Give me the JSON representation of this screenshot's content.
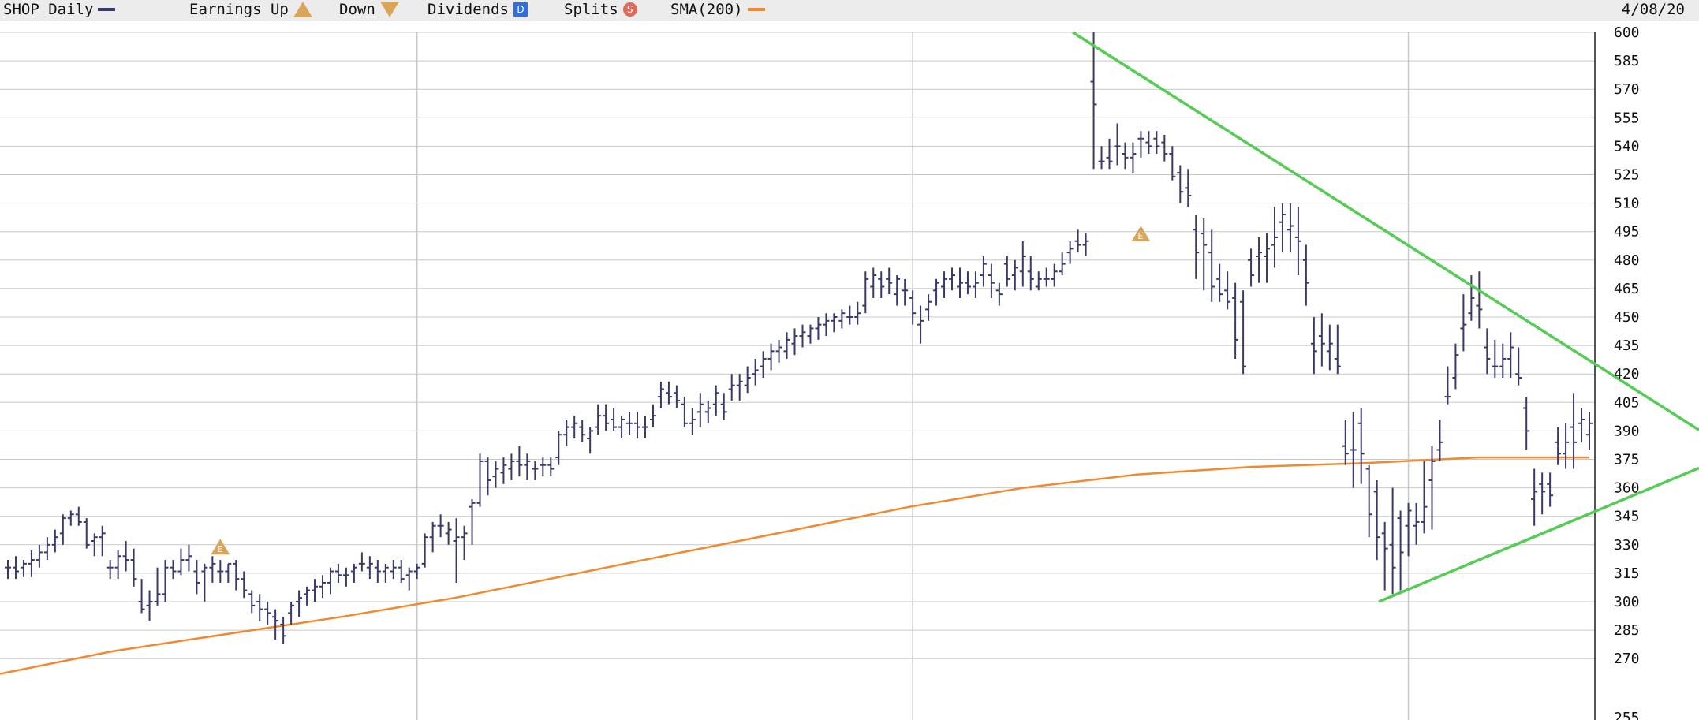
{
  "header": {
    "symbol_label": "SHOP Daily",
    "earnings_label": "Earnings Up",
    "down_label": "Down",
    "dividends_label": "Dividends",
    "splits_label": "Splits",
    "sma_label": "SMA(200)",
    "date": "4/08/20",
    "dividend_glyph": "D",
    "split_glyph": "S",
    "earnings_glyph": "E"
  },
  "colors": {
    "price_bars": "#3a3a6a",
    "sma": "#f08a30",
    "trendlines": "#55cc55",
    "earnings_marker": "#d9a55a",
    "dividend_marker": "#2f6fe0",
    "split_marker": "#e06a5a",
    "grid": "#c8c8c8"
  },
  "chart_data": {
    "type": "ohlc",
    "ticker": "SHOP",
    "interval": "Daily",
    "ylim": [
      258,
      600
    ],
    "yticks": [
      600,
      585,
      570,
      555,
      540,
      525,
      510,
      495,
      480,
      465,
      450,
      435,
      420,
      405,
      390,
      375,
      360,
      345,
      330,
      315,
      300,
      285,
      270
    ],
    "bottom_partial_tick": "255",
    "x_grid_bars": [
      52,
      115,
      178,
      235,
      307,
      373
    ],
    "ohlc": [
      [
        318,
        322,
        312,
        318
      ],
      [
        318,
        324,
        312,
        316
      ],
      [
        318,
        322,
        313,
        320
      ],
      [
        320,
        327,
        313,
        322
      ],
      [
        322,
        330,
        318,
        326
      ],
      [
        326,
        334,
        322,
        330
      ],
      [
        330,
        338,
        326,
        334
      ],
      [
        336,
        346,
        330,
        344
      ],
      [
        344,
        348,
        340,
        346
      ],
      [
        346,
        350,
        340,
        342
      ],
      [
        342,
        344,
        328,
        330
      ],
      [
        332,
        336,
        324,
        334
      ],
      [
        334,
        340,
        324,
        336
      ],
      [
        318,
        322,
        312,
        318
      ],
      [
        318,
        327,
        312,
        324
      ],
      [
        324,
        332,
        316,
        322
      ],
      [
        322,
        328,
        308,
        312
      ],
      [
        300,
        312,
        294,
        296
      ],
      [
        298,
        306,
        290,
        300
      ],
      [
        300,
        318,
        298,
        304
      ],
      [
        304,
        322,
        300,
        318
      ],
      [
        318,
        322,
        312,
        316
      ],
      [
        316,
        328,
        314,
        322
      ],
      [
        322,
        330,
        316,
        324
      ],
      [
        316,
        322,
        304,
        310
      ],
      [
        316,
        320,
        300,
        318
      ],
      [
        318,
        324,
        310,
        320
      ],
      [
        316,
        322,
        310,
        316
      ],
      [
        316,
        320,
        310,
        320
      ],
      [
        320,
        322,
        306,
        312
      ],
      [
        312,
        316,
        302,
        306
      ],
      [
        304,
        306,
        294,
        298
      ],
      [
        300,
        304,
        290,
        296
      ],
      [
        296,
        300,
        288,
        294
      ],
      [
        292,
        296,
        280,
        290
      ],
      [
        288,
        292,
        278,
        282
      ],
      [
        294,
        300,
        288,
        298
      ],
      [
        300,
        306,
        292,
        302
      ],
      [
        304,
        308,
        298,
        306
      ],
      [
        306,
        312,
        300,
        308
      ],
      [
        308,
        314,
        302,
        310
      ],
      [
        310,
        318,
        304,
        316
      ],
      [
        316,
        320,
        310,
        314
      ],
      [
        314,
        318,
        308,
        314
      ],
      [
        316,
        320,
        310,
        318
      ],
      [
        320,
        326,
        316,
        320
      ],
      [
        318,
        324,
        312,
        320
      ],
      [
        318,
        322,
        310,
        316
      ],
      [
        316,
        320,
        310,
        318
      ],
      [
        316,
        322,
        312,
        318
      ],
      [
        318,
        322,
        310,
        312
      ],
      [
        314,
        318,
        306,
        316
      ],
      [
        316,
        320,
        312,
        318
      ],
      [
        320,
        336,
        318,
        334
      ],
      [
        334,
        342,
        326,
        340
      ],
      [
        340,
        346,
        334,
        340
      ],
      [
        336,
        342,
        330,
        338
      ],
      [
        332,
        344,
        310,
        334
      ],
      [
        334,
        340,
        322,
        336
      ],
      [
        350,
        354,
        330,
        352
      ],
      [
        352,
        378,
        350,
        374
      ],
      [
        374,
        376,
        356,
        364
      ],
      [
        366,
        374,
        360,
        370
      ],
      [
        368,
        376,
        362,
        372
      ],
      [
        370,
        378,
        364,
        374
      ],
      [
        374,
        382,
        366,
        372
      ],
      [
        372,
        378,
        364,
        374
      ],
      [
        370,
        374,
        364,
        370
      ],
      [
        372,
        376,
        366,
        372
      ],
      [
        372,
        376,
        366,
        370
      ],
      [
        376,
        390,
        372,
        388
      ],
      [
        388,
        396,
        382,
        392
      ],
      [
        392,
        398,
        386,
        394
      ],
      [
        392,
        396,
        384,
        388
      ],
      [
        386,
        392,
        378,
        390
      ],
      [
        392,
        404,
        388,
        398
      ],
      [
        398,
        404,
        390,
        394
      ],
      [
        396,
        402,
        390,
        392
      ],
      [
        392,
        398,
        386,
        396
      ],
      [
        394,
        400,
        388,
        394
      ],
      [
        394,
        400,
        386,
        392
      ],
      [
        392,
        398,
        386,
        392
      ],
      [
        396,
        404,
        392,
        398
      ],
      [
        408,
        416,
        402,
        412
      ],
      [
        410,
        416,
        404,
        408
      ],
      [
        410,
        414,
        402,
        406
      ],
      [
        404,
        408,
        392,
        394
      ],
      [
        394,
        402,
        388,
        396
      ],
      [
        400,
        410,
        392,
        404
      ],
      [
        400,
        406,
        394,
        402
      ],
      [
        404,
        414,
        398,
        410
      ],
      [
        404,
        410,
        396,
        400
      ],
      [
        412,
        420,
        406,
        414
      ],
      [
        414,
        420,
        406,
        416
      ],
      [
        414,
        424,
        410,
        418
      ],
      [
        420,
        428,
        414,
        422
      ],
      [
        424,
        432,
        418,
        428
      ],
      [
        428,
        436,
        422,
        432
      ],
      [
        432,
        438,
        426,
        434
      ],
      [
        432,
        442,
        428,
        438
      ],
      [
        436,
        444,
        430,
        440
      ],
      [
        440,
        446,
        434,
        442
      ],
      [
        440,
        446,
        436,
        444
      ],
      [
        444,
        450,
        438,
        446
      ],
      [
        446,
        452,
        440,
        448
      ],
      [
        448,
        452,
        442,
        450
      ],
      [
        448,
        454,
        444,
        452
      ],
      [
        450,
        456,
        446,
        450
      ],
      [
        450,
        458,
        446,
        452
      ],
      [
        456,
        474,
        452,
        470
      ],
      [
        466,
        476,
        460,
        472
      ],
      [
        470,
        474,
        460,
        466
      ],
      [
        470,
        476,
        462,
        468
      ],
      [
        462,
        472,
        456,
        470
      ],
      [
        464,
        470,
        456,
        464
      ],
      [
        460,
        464,
        446,
        452
      ],
      [
        446,
        456,
        436,
        448
      ],
      [
        454,
        462,
        448,
        458
      ],
      [
        464,
        470,
        456,
        468
      ],
      [
        466,
        474,
        460,
        470
      ],
      [
        470,
        476,
        464,
        472
      ],
      [
        466,
        476,
        460,
        468
      ],
      [
        468,
        474,
        462,
        466
      ],
      [
        466,
        474,
        460,
        468
      ],
      [
        472,
        482,
        466,
        478
      ],
      [
        472,
        478,
        460,
        468
      ],
      [
        464,
        468,
        456,
        462
      ],
      [
        478,
        482,
        466,
        470
      ],
      [
        472,
        480,
        464,
        476
      ],
      [
        474,
        490,
        466,
        482
      ],
      [
        474,
        482,
        464,
        470
      ],
      [
        466,
        474,
        464,
        470
      ],
      [
        470,
        476,
        466,
        470
      ],
      [
        470,
        478,
        466,
        474
      ],
      [
        474,
        484,
        472,
        478
      ],
      [
        484,
        490,
        478,
        486
      ],
      [
        490,
        496,
        484,
        488
      ],
      [
        488,
        494,
        482,
        490
      ],
      [
        574,
        600,
        528,
        562
      ],
      [
        532,
        540,
        528,
        532
      ],
      [
        534,
        544,
        528,
        532
      ],
      [
        540,
        552,
        530,
        540
      ],
      [
        536,
        542,
        528,
        534
      ],
      [
        534,
        542,
        526,
        536
      ],
      [
        544,
        548,
        534,
        544
      ],
      [
        542,
        548,
        536,
        540
      ],
      [
        544,
        548,
        536,
        540
      ],
      [
        542,
        546,
        532,
        536
      ],
      [
        536,
        540,
        522,
        524
      ],
      [
        526,
        530,
        510,
        516
      ],
      [
        518,
        528,
        508,
        514
      ],
      [
        496,
        504,
        470,
        484
      ],
      [
        494,
        502,
        464,
        488
      ],
      [
        484,
        496,
        458,
        466
      ],
      [
        470,
        478,
        458,
        462
      ],
      [
        464,
        474,
        454,
        458
      ],
      [
        460,
        468,
        428,
        438
      ],
      [
        458,
        464,
        420,
        424
      ],
      [
        480,
        486,
        466,
        472
      ],
      [
        482,
        492,
        468,
        484
      ],
      [
        482,
        494,
        468,
        486
      ],
      [
        488,
        508,
        476,
        492
      ],
      [
        500,
        510,
        484,
        504
      ],
      [
        496,
        510,
        484,
        498
      ],
      [
        492,
        508,
        472,
        490
      ],
      [
        480,
        488,
        456,
        468
      ],
      [
        436,
        450,
        420,
        432
      ],
      [
        440,
        452,
        424,
        436
      ],
      [
        432,
        446,
        422,
        436
      ],
      [
        428,
        446,
        420,
        424
      ],
      [
        382,
        396,
        372,
        378
      ],
      [
        380,
        400,
        360,
        380
      ],
      [
        394,
        402,
        362,
        378
      ],
      [
        370,
        372,
        334,
        346
      ],
      [
        358,
        364,
        322,
        334
      ],
      [
        336,
        342,
        306,
        328
      ],
      [
        330,
        360,
        304,
        318
      ],
      [
        344,
        348,
        306,
        326
      ],
      [
        340,
        352,
        324,
        348
      ],
      [
        340,
        352,
        330,
        342
      ],
      [
        342,
        374,
        336,
        350
      ],
      [
        364,
        382,
        338,
        374
      ],
      [
        380,
        396,
        374,
        384
      ],
      [
        408,
        424,
        404,
        408
      ],
      [
        418,
        436,
        412,
        430
      ],
      [
        444,
        462,
        432,
        446
      ],
      [
        452,
        472,
        448,
        460
      ],
      [
        456,
        474,
        444,
        454
      ],
      [
        434,
        444,
        420,
        428
      ],
      [
        424,
        438,
        418,
        424
      ],
      [
        424,
        436,
        418,
        428
      ],
      [
        428,
        442,
        418,
        434
      ],
      [
        420,
        434,
        414,
        418
      ],
      [
        402,
        408,
        380,
        390
      ],
      [
        354,
        370,
        340,
        358
      ],
      [
        362,
        368,
        346,
        358
      ],
      [
        362,
        368,
        350,
        356
      ],
      [
        384,
        392,
        372,
        378
      ],
      [
        378,
        394,
        370,
        384
      ],
      [
        392,
        410,
        370,
        384
      ],
      [
        394,
        402,
        384,
        396
      ],
      [
        388,
        400,
        380,
        394
      ]
    ],
    "sma200": [
      [
        0,
        262
      ],
      [
        50,
        274
      ],
      [
        100,
        283
      ],
      [
        150,
        292
      ],
      [
        200,
        302
      ],
      [
        250,
        314
      ],
      [
        300,
        326
      ],
      [
        350,
        338
      ],
      [
        400,
        350
      ],
      [
        450,
        360
      ],
      [
        500,
        367
      ],
      [
        550,
        371
      ],
      [
        600,
        373
      ],
      [
        650,
        376
      ],
      [
        699,
        376
      ]
    ],
    "trendlines": [
      {
        "from": [
          0.0,
          600
        ],
        "to": [
          1.0,
          405
        ]
      },
      {
        "from": [
          0.0,
          300
        ],
        "to": [
          1.0,
          385
        ]
      }
    ],
    "earnings_markers": [
      {
        "bar": 27,
        "value": 329
      },
      {
        "bar": 144,
        "value": 494
      }
    ]
  }
}
